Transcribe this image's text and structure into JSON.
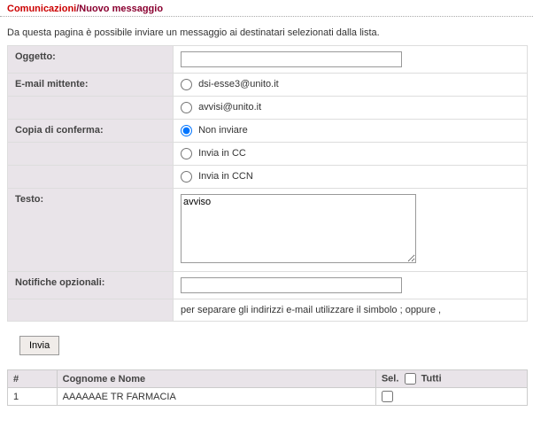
{
  "header": {
    "part1": "Comunicazioni",
    "sep": "/",
    "part2": "Nuovo messaggio"
  },
  "intro": "Da questa pagina è possibile inviare un messaggio ai destinatari selezionati dalla lista.",
  "form": {
    "oggetto_label": "Oggetto:",
    "oggetto_value": "",
    "mittente_label": "E-mail mittente:",
    "mittente_options": [
      "dsi-esse3@unito.it",
      "avvisi@unito.it"
    ],
    "conferma_label": "Copia di conferma:",
    "conferma_options": [
      "Non inviare",
      "Invia in CC",
      "Invia in CCN"
    ],
    "conferma_selected": "Non inviare",
    "testo_label": "Testo:",
    "testo_value": "avviso",
    "notifiche_label": "Notifiche opzionali:",
    "notifiche_value": "",
    "notifiche_help": "per separare gli indirizzi e-mail utilizzare il simbolo ; oppure ,",
    "submit_label": "Invia"
  },
  "grid": {
    "col_idx": "#",
    "col_name": "Cognome e Nome",
    "col_sel": "Sel.",
    "col_tutti": "Tutti",
    "rows": [
      {
        "idx": "1",
        "name": "AAAAAAE TR FARMACIA",
        "sel": false
      }
    ]
  }
}
